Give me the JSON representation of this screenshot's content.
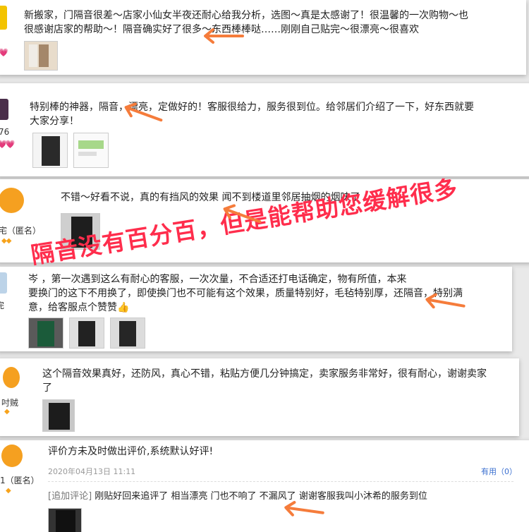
{
  "reviews": [
    {
      "text": "新搬家，门隔音很差～店家小仙女半夜还耐心给我分析，选图～真是太感谢了！很温馨的一次购物～也\n很感谢店家的帮助～！隔音确实好了很多～东西棒棒哒……刚刚自己贴完～很漂亮～很喜欢"
    },
    {
      "text": "特别棒的神器，隔音，漂亮，定做好的！客服很给力，服务很到位。给邻居们介绍了一下，好东西就要\n大家分享！",
      "name": "76"
    },
    {
      "text": "不错～好看不说，真的有挡风的效果 闻不到楼道里邻居抽烟的烟味了",
      "name": "宅（匿名）"
    },
    {
      "text": "岑       ，第一次遇到这么有耐心的客服，一次次量，不合适还打电话确定，物有所值，本来\n要换门的这下不用换了，即使换门也不可能有这个效果，质量特别好，毛毡特别厚，还隔音，特别满\n意，给客服点个赞赞👍",
      "name": "完"
    },
    {
      "text": "这个隔音效果真好，还防风，真心不错，粘贴方便几分钟搞定，卖家服务非常好，很有耐心，谢谢卖家\n了",
      "name": "吋贼"
    },
    {
      "text": "评价方未及时做出评价,系统默认好评!",
      "name": "1（匿名）",
      "date": "2020年04月13日  11:11",
      "useful": "有用（0）",
      "append_tag": "[追加评论]",
      "append_text": " 刚贴好回来追评了 相当漂亮 门也不响了 不漏风了 谢谢客服我叫小沐希的服务到位"
    }
  ],
  "overlay_text": "隔音没有百分百，但是能帮助您缓解很多",
  "icons": {
    "diamond": "diamond-icon",
    "heart": "heart-icon",
    "thumbs_up": "thumbs-up-icon",
    "arrow": "orange-arrow"
  },
  "colors": {
    "arrow": "#f57c3b",
    "overlay_text": "#ff2d4c",
    "useful_link": "#3a6fd0",
    "avatar_orange": "#f5a020"
  }
}
